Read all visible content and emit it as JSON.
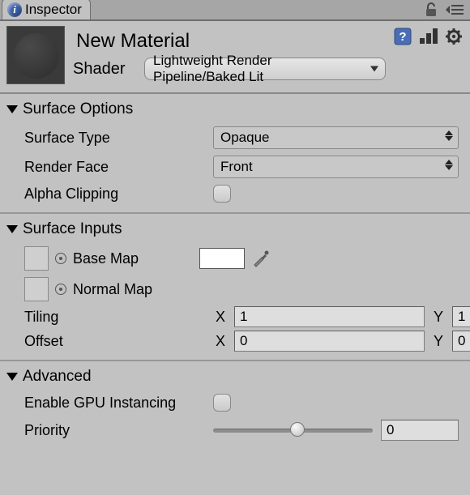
{
  "tab": {
    "title": "Inspector"
  },
  "material": {
    "name": "New Material"
  },
  "shader": {
    "label": "Shader",
    "value": "Lightweight Render Pipeline/Baked Lit"
  },
  "sections": {
    "surfaceOptions": {
      "title": "Surface Options",
      "surfaceType": {
        "label": "Surface Type",
        "value": "Opaque"
      },
      "renderFace": {
        "label": "Render Face",
        "value": "Front"
      },
      "alphaClipping": {
        "label": "Alpha Clipping",
        "checked": false
      }
    },
    "surfaceInputs": {
      "title": "Surface Inputs",
      "baseMap": {
        "label": "Base Map",
        "color": "#ffffff"
      },
      "normalMap": {
        "label": "Normal Map"
      },
      "tiling": {
        "label": "Tiling",
        "x": "1",
        "y": "1"
      },
      "offset": {
        "label": "Offset",
        "x": "0",
        "y": "0"
      }
    },
    "advanced": {
      "title": "Advanced",
      "gpuInstancing": {
        "label": "Enable GPU Instancing",
        "checked": false
      },
      "priority": {
        "label": "Priority",
        "value": "0"
      }
    }
  }
}
